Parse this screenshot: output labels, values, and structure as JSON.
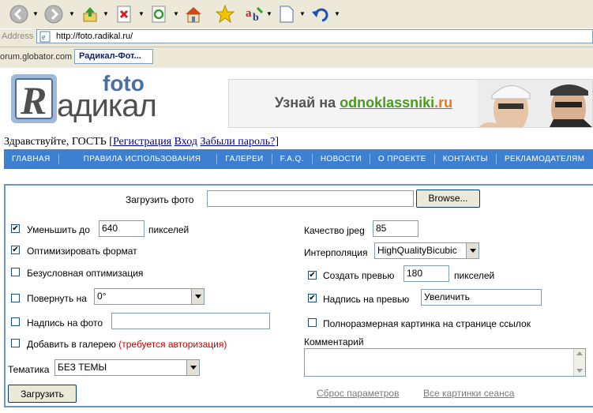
{
  "browser": {
    "address_label": "Address",
    "url": "http://foto.radikal.ru/",
    "links_text": "orum.globator.com :",
    "active_tab": "Радикал-Фот..."
  },
  "site": {
    "logo_foto": "foto",
    "logo_r": "R",
    "logo_rest": "адикал",
    "banner_text": "Узнай на ",
    "banner_link_a": "odnoklassniki",
    "banner_link_b": ".ru",
    "greeting": "Здравствуйте, ГОСТЬ",
    "bracket_open": "[",
    "bracket_close": "]",
    "register": "Регистрация",
    "login": "Вход",
    "forgot": "Забыли пароль?"
  },
  "nav": [
    "ГЛАВНАЯ",
    "ПРАВИЛА ИСПОЛЬЗОВАНИЯ",
    "ГАЛЕРЕИ",
    "F.A.Q.",
    "НОВОСТИ",
    "О ПРОЕКТЕ",
    "КОНТАКТЫ",
    "РЕКЛАМОДАТЕЛЯМ"
  ],
  "form": {
    "upload_label": "Загрузить фото",
    "browse": "Browse...",
    "reduce_label": "Уменьшить до",
    "reduce_value": "640",
    "pixels": "пикселей",
    "optimize_format": "Оптимизировать формат",
    "unconditional": "Безусловная оптимизация",
    "rotate_label": "Повернуть на",
    "rotate_value": "0°",
    "caption_label": "Надпись на фото",
    "add_gallery": "Добавить в галерею",
    "auth_required": "(требуется авторизация)",
    "theme_label": "Тематика",
    "theme_value": "БЕЗ ТЕМЫ",
    "jpeg_label": "Качество jpeg",
    "jpeg_value": "85",
    "interp_label": "Интерполяция",
    "interp_value": "HighQualityBicubic",
    "preview_label": "Создать превью",
    "preview_value": "180",
    "preview_caption_label": "Надпись на превью",
    "preview_caption_value": "Увеличить",
    "fullsize_label": "Полноразмерная картинка на странице ссылок",
    "comment_label": "Комментарий",
    "submit": "Загрузить",
    "reset": "Сброс параметров",
    "all_images": "Все картинки сеанса",
    "check": "✔"
  }
}
